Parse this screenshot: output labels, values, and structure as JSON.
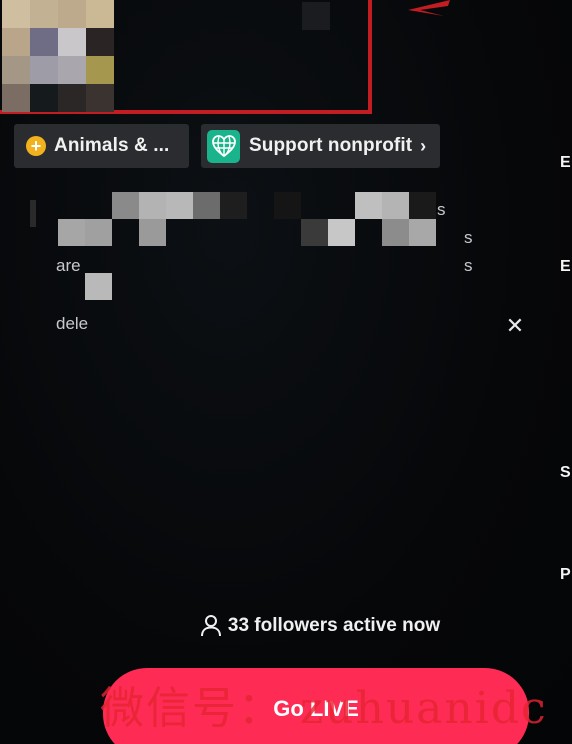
{
  "categories": [
    {
      "label": "Animals & ...",
      "icon": "plus-circle-icon",
      "icon_color": "#f1b21e"
    },
    {
      "label": "Support nonprofit",
      "icon": "globe-heart-icon",
      "icon_color": "#19b48c"
    }
  ],
  "description": {
    "fragments": [
      "s",
      "s",
      "are",
      "s",
      "dele"
    ]
  },
  "right_edge_letters": [
    "E",
    "E",
    "S",
    "P"
  ],
  "followers": {
    "text": "33 followers active now",
    "icon": "person-icon"
  },
  "go_live": {
    "label": "Go LIVE",
    "color": "#fe2c55"
  },
  "annotation": {
    "highlight_color": "#c11d22"
  },
  "watermark": {
    "text": "微信号：   zuhuanidc"
  },
  "colors": {
    "background": "#050608",
    "chip_background": "#2a2c2f"
  }
}
